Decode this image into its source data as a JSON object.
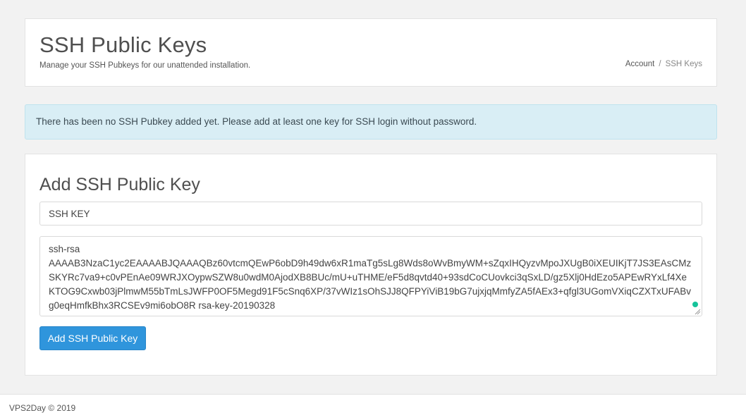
{
  "header": {
    "title": "SSH Public Keys",
    "subtitle": "Manage your SSH Pubkeys for our unattended installation.",
    "breadcrumb": {
      "items": [
        "Account",
        "SSH Keys"
      ],
      "separator": "/"
    }
  },
  "alert": {
    "text": "There has been no SSH Pubkey added yet. Please add at least one key for SSH login without password."
  },
  "form": {
    "title": "Add SSH Public Key",
    "name_value": "SSH KEY",
    "key_value": "ssh-rsa\nAAAAB3NzaC1yc2EAAAABJQAAAQBz60vtcmQEwP6obD9h49dw6xR1maTg5sLg8Wds8oWvBmyWM+sZqxIHQyzvMpoJXUgB0iXEUIKjT7JS3EAsCMzSKYRc7va9+c0vPEnAe09WRJXOypwSZW8u0wdM0AjodXB8BUc/mU+uTHME/eF5d8qvtd40+93sdCoCUovkci3qSxLD/gz5Xlj0HdEzo5APEwRYxLf4XeKTOG9Cxwb03jPlmwM55bTmLsJWFP0OF5Megd91F5cSnq6XP/37vWIz1sOhSJJ8QFPYiViB19bG7ujxjqMmfyZA5fAEx3+qfgl3UGomVXiqCZXTxUFABvg0eqHmfkBhx3RCSEv9mi6obO8R rsa-key-20190328",
    "submit_label": "Add SSH Public Key"
  },
  "footer": {
    "text": "VPS2Day © 2019"
  },
  "colors": {
    "accent": "#2f95dc",
    "alert_bg": "#d9eef5",
    "grammar_dot": "#15c39a"
  }
}
